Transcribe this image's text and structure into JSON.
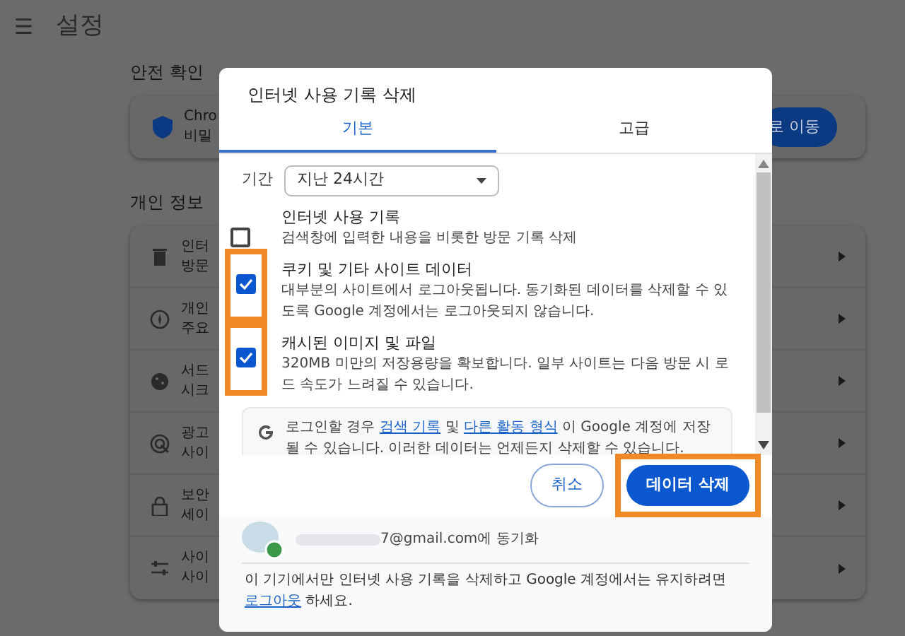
{
  "header": {
    "menu_glyph": "☰",
    "title": "설정"
  },
  "safety": {
    "heading": "안전 확인",
    "card_title": "Chro",
    "card_desc": "비밀",
    "button": "로 이동"
  },
  "privacy": {
    "heading": "개인 정보",
    "rows": [
      {
        "kind": "trash",
        "title": "인터",
        "desc": "방문"
      },
      {
        "kind": "compass",
        "title": "개인",
        "desc": "주요"
      },
      {
        "kind": "cookie",
        "title": "서드",
        "desc": "시크"
      },
      {
        "kind": "ads",
        "title": "광고",
        "desc": "사이"
      },
      {
        "kind": "lock",
        "title": "보안",
        "desc": "세이"
      },
      {
        "kind": "sliders",
        "title": "사이",
        "desc": "사이"
      }
    ]
  },
  "dialog": {
    "title": "인터넷 사용 기록 삭제",
    "tabs": [
      {
        "label": "기본",
        "selected": true
      },
      {
        "label": "고급",
        "selected": false
      }
    ],
    "period_label": "기간",
    "period_value": "지난 24시간",
    "options": [
      {
        "title": "인터넷 사용 기록",
        "description": "검색창에 입력한 내용을 비롯한 방문 기록 삭제",
        "checked": false,
        "highlighted": false
      },
      {
        "title": "쿠키 및 기타 사이트 데이터",
        "description": "대부분의 사이트에서 로그아웃됩니다. 동기화된 데이터를 삭제할 수 있도록 Google 계정에서는 로그아웃되지 않습니다.",
        "checked": true,
        "highlighted": true
      },
      {
        "title": "캐시된 이미지 및 파일",
        "description": "320MB 미만의 저장용량을 확보합니다. 일부 사이트는 다음 방문 시 로드 속도가 느려질 수 있습니다.",
        "checked": true,
        "highlighted": true
      }
    ],
    "info": [
      {
        "text": "로그인할 경우",
        "kind": "text"
      },
      {
        "text": "검색 기록",
        "kind": "link"
      },
      {
        "text": "및",
        "kind": "text"
      },
      {
        "text": "다른 활동 형식",
        "kind": "link"
      },
      {
        "text": "이 Google 계정에 저장될 수 있습니다. 이러한 데이터는 언제든지 삭제할 수 있습니다.",
        "kind": "text"
      }
    ],
    "buttons": [
      {
        "label": "취소",
        "kind": "secondary",
        "highlighted": false
      },
      {
        "label": "데이터 삭제",
        "kind": "primary",
        "highlighted": true
      }
    ],
    "account": "7@gmail.com에 동기화",
    "note": [
      {
        "text": "이 기기에서만 인터넷 사용 기록을 삭제하고 Google 계정에서는 유지하려면",
        "kind": "text"
      },
      {
        "text": "로그아웃",
        "kind": "link"
      },
      {
        "text": "하세요.",
        "kind": "text"
      }
    ]
  }
}
